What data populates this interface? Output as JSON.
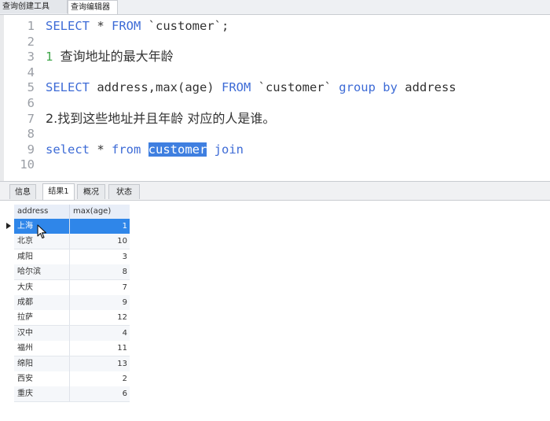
{
  "top_tabs": [
    "查询创建工具",
    "查询编辑器"
  ],
  "editor": {
    "lines": [
      {
        "n": "1",
        "parts": [
          {
            "t": "SELECT",
            "c": "kw"
          },
          {
            "t": " * ",
            "c": "str"
          },
          {
            "t": "FROM",
            "c": "kw"
          },
          {
            "t": " `customer`;",
            "c": "str"
          }
        ]
      },
      {
        "n": "2",
        "parts": []
      },
      {
        "n": "3",
        "parts": [
          {
            "t": "1 ",
            "c": "num-c"
          },
          {
            "t": "查询地址的最大年龄",
            "c": "cmt"
          }
        ]
      },
      {
        "n": "4",
        "parts": []
      },
      {
        "n": "5",
        "parts": [
          {
            "t": "SELECT",
            "c": "kw"
          },
          {
            "t": " address,max(age) ",
            "c": "str"
          },
          {
            "t": "FROM",
            "c": "kw"
          },
          {
            "t": " `customer` ",
            "c": "str"
          },
          {
            "t": "group by",
            "c": "kw"
          },
          {
            "t": " address",
            "c": "str"
          }
        ]
      },
      {
        "n": "6",
        "parts": []
      },
      {
        "n": "7",
        "parts": [
          {
            "t": "2.找到这些地址并且年龄 对应的人是谁。",
            "c": "cmt"
          }
        ]
      },
      {
        "n": "8",
        "parts": []
      },
      {
        "n": "9",
        "parts": [
          {
            "t": "select",
            "c": "kw"
          },
          {
            "t": " * ",
            "c": "str"
          },
          {
            "t": "from",
            "c": "kw"
          },
          {
            "t": " ",
            "c": "str"
          },
          {
            "t": "customer",
            "c": "sel"
          },
          {
            "t": " ",
            "c": "str"
          },
          {
            "t": "join",
            "c": "kw"
          }
        ]
      },
      {
        "n": "10",
        "parts": []
      }
    ]
  },
  "result_tabs": [
    "信息",
    "结果1",
    "概况",
    "状态"
  ],
  "active_result_tab": "结果1",
  "grid": {
    "columns": [
      "address",
      "max(age)"
    ],
    "rows": [
      {
        "address": "上海",
        "max_age": "1"
      },
      {
        "address": "北京",
        "max_age": "10"
      },
      {
        "address": "咸阳",
        "max_age": "3"
      },
      {
        "address": "哈尔滨",
        "max_age": "8"
      },
      {
        "address": "大庆",
        "max_age": "7"
      },
      {
        "address": "成都",
        "max_age": "9"
      },
      {
        "address": "拉萨",
        "max_age": "12"
      },
      {
        "address": "汉中",
        "max_age": "4"
      },
      {
        "address": "福州",
        "max_age": "11"
      },
      {
        "address": "绵阳",
        "max_age": "13"
      },
      {
        "address": "西安",
        "max_age": "2"
      },
      {
        "address": "重庆",
        "max_age": "6"
      }
    ],
    "selected_row": 0
  }
}
